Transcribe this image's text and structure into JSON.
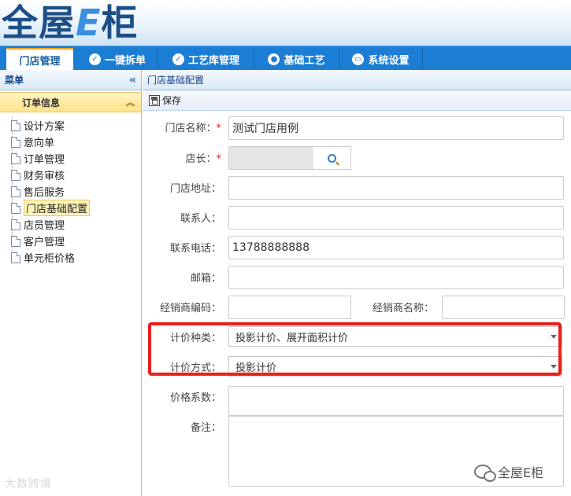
{
  "app": {
    "logo_text": "全屋",
    "logo_e": "E",
    "logo_tail": "柜"
  },
  "nav": {
    "tabs": [
      {
        "label": "门店管理",
        "icon": ""
      },
      {
        "label": "一键拆单",
        "icon": "check-circle-icon"
      },
      {
        "label": "工艺库管理",
        "icon": "check-circle-icon"
      },
      {
        "label": "基础工艺",
        "icon": "drop-icon"
      },
      {
        "label": "系统设置",
        "icon": "monitor-icon"
      }
    ]
  },
  "sidebar": {
    "title": "菜单",
    "collapse_icon": "double-chevron-left-icon",
    "group_label": "订单信息",
    "group_icon": "double-chevron-up-icon",
    "items": [
      {
        "label": "设计方案"
      },
      {
        "label": "意向单"
      },
      {
        "label": "订单管理"
      },
      {
        "label": "财务审核"
      },
      {
        "label": "售后服务"
      },
      {
        "label": "门店基础配置",
        "selected": true
      },
      {
        "label": "店员管理"
      },
      {
        "label": "客户管理"
      },
      {
        "label": "单元柜价格"
      }
    ]
  },
  "main": {
    "breadcrumb": "门店基础配置",
    "toolbar": {
      "save_label": "保存"
    },
    "form": {
      "store_name": {
        "label": "门店名称：",
        "required": "*",
        "value": "测试门店用例"
      },
      "manager": {
        "label": "店长：",
        "required": "*",
        "value": ""
      },
      "address": {
        "label": "门店地址：",
        "value": ""
      },
      "contact": {
        "label": "联系人：",
        "value": ""
      },
      "phone": {
        "label": "联系电话：",
        "value": "13788888888"
      },
      "email": {
        "label": "邮箱：",
        "value": ""
      },
      "dealer_code": {
        "label": "经销商编码：",
        "value": ""
      },
      "dealer_name": {
        "label": "经销商名称：",
        "value": ""
      },
      "pricing_type": {
        "label": "计价种类：",
        "value": "投影计价、展开面积计价"
      },
      "pricing_method": {
        "label": "计价方式：",
        "value": "投影计价"
      },
      "price_coef": {
        "label": "价格系数：",
        "value": ""
      },
      "remark": {
        "label": "备注：",
        "value": ""
      }
    }
  },
  "watermarks": {
    "left": "大数跨境",
    "right": "全屋E柜"
  },
  "colors": {
    "nav": "#1b7dd4",
    "highlight_box": "#e8201a"
  }
}
